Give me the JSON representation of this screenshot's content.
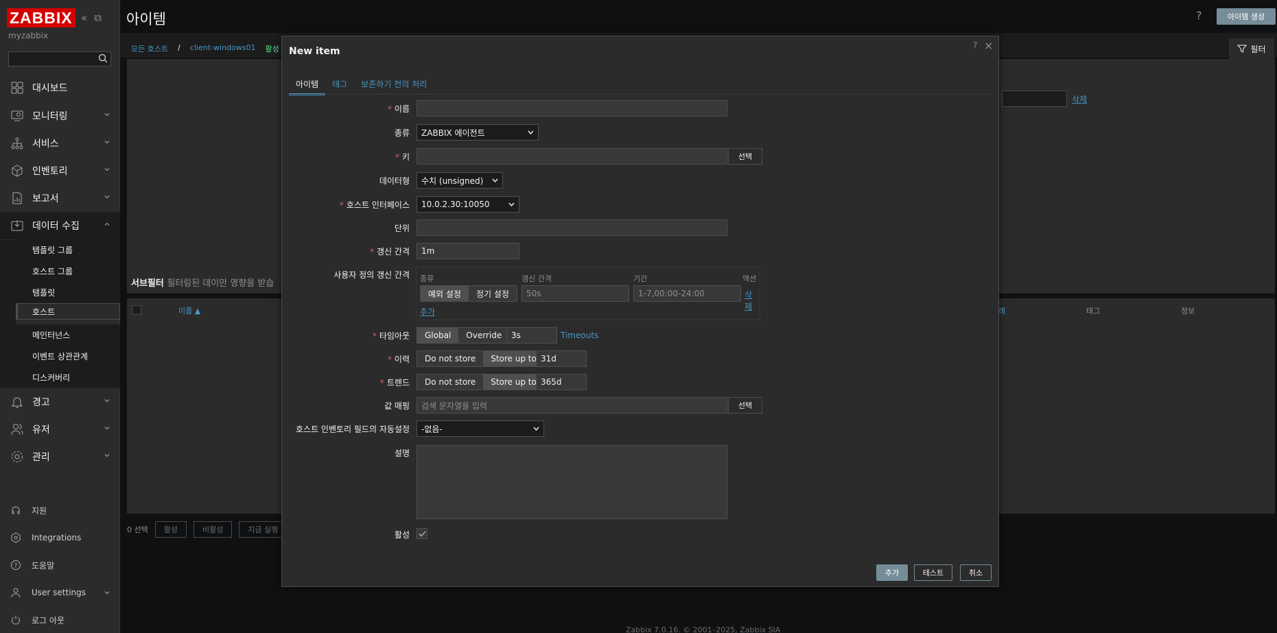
{
  "sidebar": {
    "logo": "ZABBIX",
    "server": "myzabbix",
    "search_placeholder": "",
    "nav": [
      {
        "label": "대시보드",
        "icon": "dashboard-icon"
      },
      {
        "label": "모니터링",
        "icon": "monitoring-icon"
      },
      {
        "label": "서비스",
        "icon": "services-icon"
      },
      {
        "label": "인벤토리",
        "icon": "inventory-icon"
      },
      {
        "label": "보고서",
        "icon": "reports-icon"
      },
      {
        "label": "데이터 수집",
        "icon": "data-collection-icon"
      }
    ],
    "sub": [
      "템플릿 그룹",
      "호스트 그룹",
      "템플릿",
      "호스트",
      "메인터넌스",
      "이벤트 상관관계",
      "디스커버리"
    ],
    "nav2": [
      {
        "label": "경고",
        "icon": "alerts-icon"
      },
      {
        "label": "유저",
        "icon": "users-icon"
      },
      {
        "label": "관리",
        "icon": "administration-icon"
      }
    ],
    "bottom": [
      {
        "label": "지원",
        "icon": "support-icon"
      },
      {
        "label": "Integrations",
        "icon": "integrations-icon"
      },
      {
        "label": "도움말",
        "icon": "help-icon"
      },
      {
        "label": "User settings",
        "icon": "user-settings-icon"
      },
      {
        "label": "로그 아웃",
        "icon": "logout-icon"
      }
    ]
  },
  "page": {
    "title": "아이템",
    "help": "?",
    "create_button": "아이템 생성",
    "breadcrumb": {
      "all_hosts": "모든 호스트",
      "sep": "/",
      "host": "client-windows01",
      "status": "활성"
    },
    "filter_tab": "필터",
    "bg_delete": "삭제",
    "subfilter_label": "서브필터",
    "subfilter_note": "필터링된 데이만 영향을 받습",
    "table_headers": {
      "name": "이름 ▲",
      "tail": "례",
      "tags": "태그",
      "info": "정보"
    },
    "bottom": {
      "selected": "0 선택",
      "enable": "활성",
      "disable": "비활성",
      "execute": "지금 실행"
    },
    "footer": "Zabbix 7.0.16. © 2001–2025, Zabbix SIA"
  },
  "dialog": {
    "title": "New item",
    "help": "?",
    "close": "×",
    "tabs": [
      "아이템",
      "태그",
      "보존하기 전의 처리"
    ],
    "fields": {
      "name": {
        "label": "이름",
        "value": ""
      },
      "type": {
        "label": "종류",
        "value": "ZABBIX 에이전트"
      },
      "key": {
        "label": "키",
        "value": "",
        "select": "선택"
      },
      "value_type": {
        "label": "데이터형",
        "value": "수치 (unsigned)"
      },
      "interface": {
        "label": "호스트 인터페이스",
        "value": "10.0.2.30:10050"
      },
      "units": {
        "label": "단위",
        "value": ""
      },
      "delay": {
        "label": "갱신 간격",
        "value": "1m"
      },
      "custom_intervals": {
        "label": "사용자 정의 갱신 간격",
        "headers": [
          "종류",
          "갱신 간격",
          "기간",
          "액션"
        ],
        "mode_flexible": "예외 설정",
        "mode_scheduling": "정기 설정",
        "interval": "50s",
        "period": "1-7,00:00-24:00",
        "remove": "삭제",
        "add": "추가"
      },
      "timeout": {
        "label": "타임아웃",
        "global": "Global",
        "override": "Override",
        "value": "3s",
        "link": "Timeouts"
      },
      "history": {
        "label": "이력",
        "do_not_store": "Do not store",
        "store_up_to": "Store up to",
        "value": "31d"
      },
      "trends": {
        "label": "트렌드",
        "do_not_store": "Do not store",
        "store_up_to": "Store up to",
        "value": "365d"
      },
      "valuemap": {
        "label": "값 매핑",
        "placeholder": "검색 문자열을 입력",
        "select": "선택"
      },
      "inventory_link": {
        "label": "호스트 인벤토리 필드의 자동설정",
        "value": "-없음-"
      },
      "description": {
        "label": "설명",
        "value": ""
      },
      "enabled": {
        "label": "활성",
        "checked": true
      }
    },
    "buttons": {
      "add": "추가",
      "test": "테스트",
      "cancel": "취소"
    }
  },
  "colors": {
    "accent": "#4796c4",
    "required": "#e45959",
    "logo": "#d40000",
    "primary_button": "#768d99"
  }
}
